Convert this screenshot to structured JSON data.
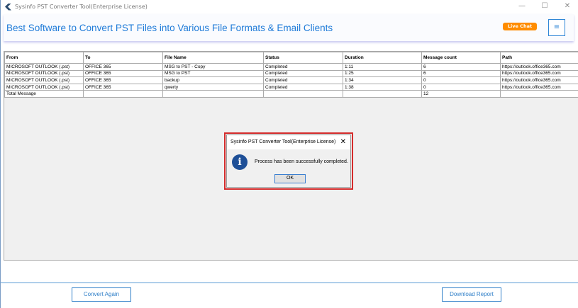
{
  "window": {
    "title": "Sysinfo PST Converter Tool(Enterprise License)"
  },
  "banner": {
    "headline": "Best Software to Convert PST Files into Various File Formats & Email Clients",
    "live_chat": "Live Chat",
    "menu_icon": "≡"
  },
  "table": {
    "headers": [
      "From",
      "To",
      "File Name",
      "Status",
      "Duration",
      "Message count",
      "Path"
    ],
    "rows": [
      [
        "MICROSOFT OUTLOOK (.pst)",
        "OFFICE 365",
        "MSG to PST - Copy",
        "Completed",
        "1:11",
        "6",
        "https://outlook.office365.com"
      ],
      [
        "MICROSOFT OUTLOOK (.pst)",
        "OFFICE 365",
        "MSG to PST",
        "Completed",
        "1:25",
        "6",
        "https://outlook.office365.com"
      ],
      [
        "MICROSOFT OUTLOOK (.pst)",
        "OFFICE 365",
        "backup",
        "Completed",
        "1:34",
        "0",
        "https://outlook.office365.com"
      ],
      [
        "MICROSOFT OUTLOOK (.pst)",
        "OFFICE 365",
        "qwerty",
        "Completed",
        "1:38",
        "0",
        "https://outlook.office365.com"
      ]
    ],
    "total": {
      "label": "Total Message",
      "count": "12"
    }
  },
  "dialog": {
    "title": "Sysinfo PST Converter Tool(Enterprise License)",
    "message": "Process has been successfully completed.",
    "ok": "OK"
  },
  "footer": {
    "convert_again": "Convert Again",
    "download_report": "Download Report"
  }
}
